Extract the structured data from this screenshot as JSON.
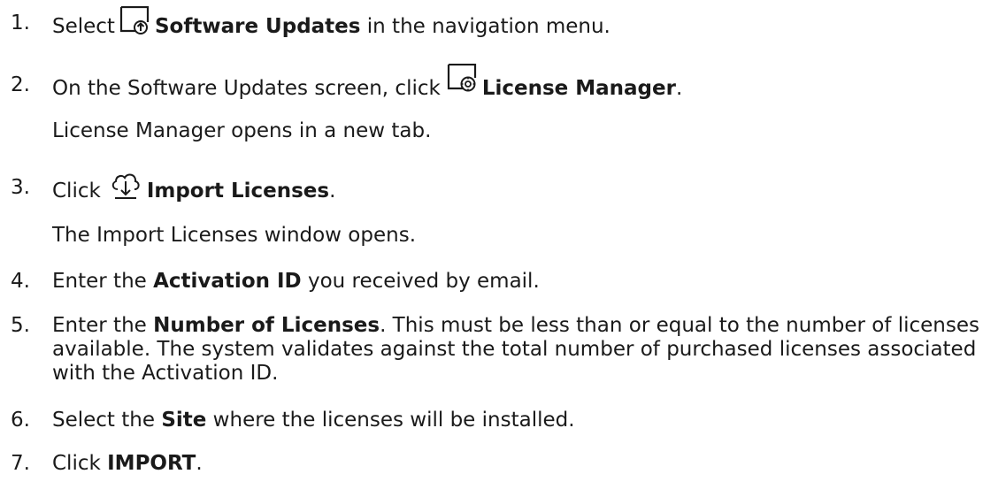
{
  "steps": [
    {
      "num": "1.",
      "pre": "Select",
      "icon": "software-updates-icon",
      "bold": "Software Updates",
      "post": " in the navigation menu."
    },
    {
      "num": "2.",
      "pre": "On the Software Updates screen, click",
      "icon": "license-manager-icon",
      "bold": "License Manager",
      "post": ".",
      "result": "License Manager opens in a new tab."
    },
    {
      "num": "3.",
      "pre": "Click",
      "icon": "cloud-download-icon",
      "bold": "Import Licenses",
      "post": ".",
      "result": "The Import Licenses window opens."
    },
    {
      "num": "4.",
      "pre": "Enter the ",
      "bold": "Activation ID",
      "post": " you received by email."
    },
    {
      "num": "5.",
      "pre": "Enter the ",
      "bold": "Number of Licenses",
      "post": ". This must be less than or equal to the number of licenses available. The system validates against the total number of purchased licenses associated with the Activation ID."
    },
    {
      "num": "6.",
      "pre": "Select the ",
      "bold": "Site",
      "post": " where the licenses will be installed."
    },
    {
      "num": "7.",
      "pre": "Click ",
      "bold": "IMPORT",
      "post": "."
    }
  ]
}
